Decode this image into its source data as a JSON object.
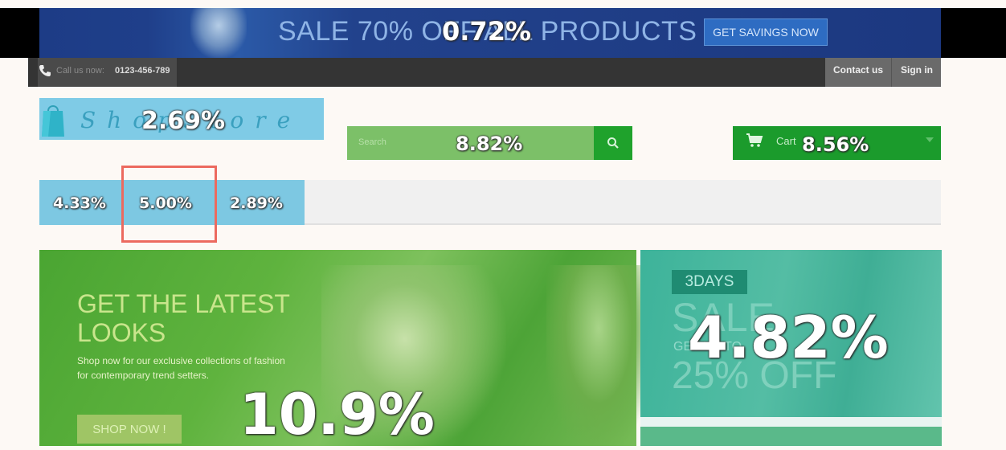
{
  "banner": {
    "text": "SALE 70% OFF ALL PRODUCTS",
    "button_label": "GET SAVINGS NOW",
    "overlay_value": "0.72%"
  },
  "nav": {
    "phone_label": "Call us now:",
    "phone_number": "0123-456-789",
    "contact_label": "Contact us",
    "signin_label": "Sign in"
  },
  "logo": {
    "text": "ShopStore",
    "overlay_value": "2.69%"
  },
  "search": {
    "placeholder": "Search",
    "overlay_value": "8.82%",
    "button_icon": "search-icon"
  },
  "cart": {
    "label": "Cart",
    "overlay_value": "8.56%",
    "icon": "cart-icon"
  },
  "menu": {
    "items": [
      {
        "value": "4.33%"
      },
      {
        "value": "5.00%"
      },
      {
        "value": "2.89%"
      }
    ]
  },
  "hero": {
    "title": "GET THE LATEST LOOKS",
    "description": "Shop now for our exclusive collections of fashion for contemporary trend setters.",
    "button_label": "SHOP NOW !",
    "overlay_value": "10.9%"
  },
  "promo": {
    "badge": "3DAYS",
    "ghost_line_1": "SALE",
    "ghost_line_2": "GET UP TO",
    "ghost_line_3": "25% OFF",
    "overlay_value": "4.82%"
  },
  "colors": {
    "banner": "#1d3c86",
    "accent_green": "#1b9b2c",
    "menu_blue": "#7dc8e2",
    "highlight": "#ec6a5f",
    "promo_teal": "#3db39a"
  }
}
